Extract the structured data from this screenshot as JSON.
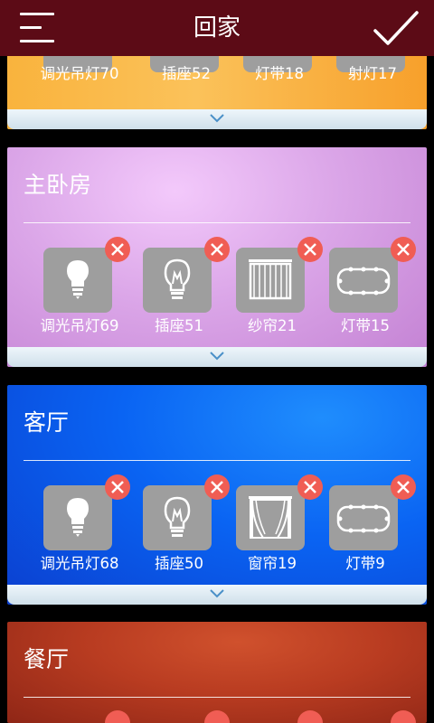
{
  "header": {
    "title": "回家",
    "menu_icon": "hamburger-menu-icon",
    "confirm_icon": "checkmark-icon"
  },
  "rooms": [
    {
      "name": "",
      "color": "#f7a02b",
      "devices": [
        {
          "label": "调光吊灯70",
          "icon": "bulb-icon"
        },
        {
          "label": "插座52",
          "icon": "lamp-icon"
        },
        {
          "label": "灯带18",
          "icon": "light-strip-icon"
        },
        {
          "label": "射灯17",
          "icon": "spotlight-icon"
        }
      ]
    },
    {
      "name": "主卧房",
      "color": "#d49be0",
      "devices": [
        {
          "label": "调光吊灯69",
          "icon": "bulb-icon"
        },
        {
          "label": "插座51",
          "icon": "lamp-icon"
        },
        {
          "label": "纱帘21",
          "icon": "sheer-curtain-icon"
        },
        {
          "label": "灯带15",
          "icon": "light-strip-icon"
        }
      ]
    },
    {
      "name": "客厅",
      "color": "#0a5cf2",
      "devices": [
        {
          "label": "调光吊灯68",
          "icon": "bulb-icon"
        },
        {
          "label": "插座50",
          "icon": "lamp-icon"
        },
        {
          "label": "窗帘19",
          "icon": "curtain-icon"
        },
        {
          "label": "灯带9",
          "icon": "light-strip-icon"
        }
      ]
    },
    {
      "name": "餐厅",
      "color": "#b43a1f",
      "devices": []
    }
  ]
}
